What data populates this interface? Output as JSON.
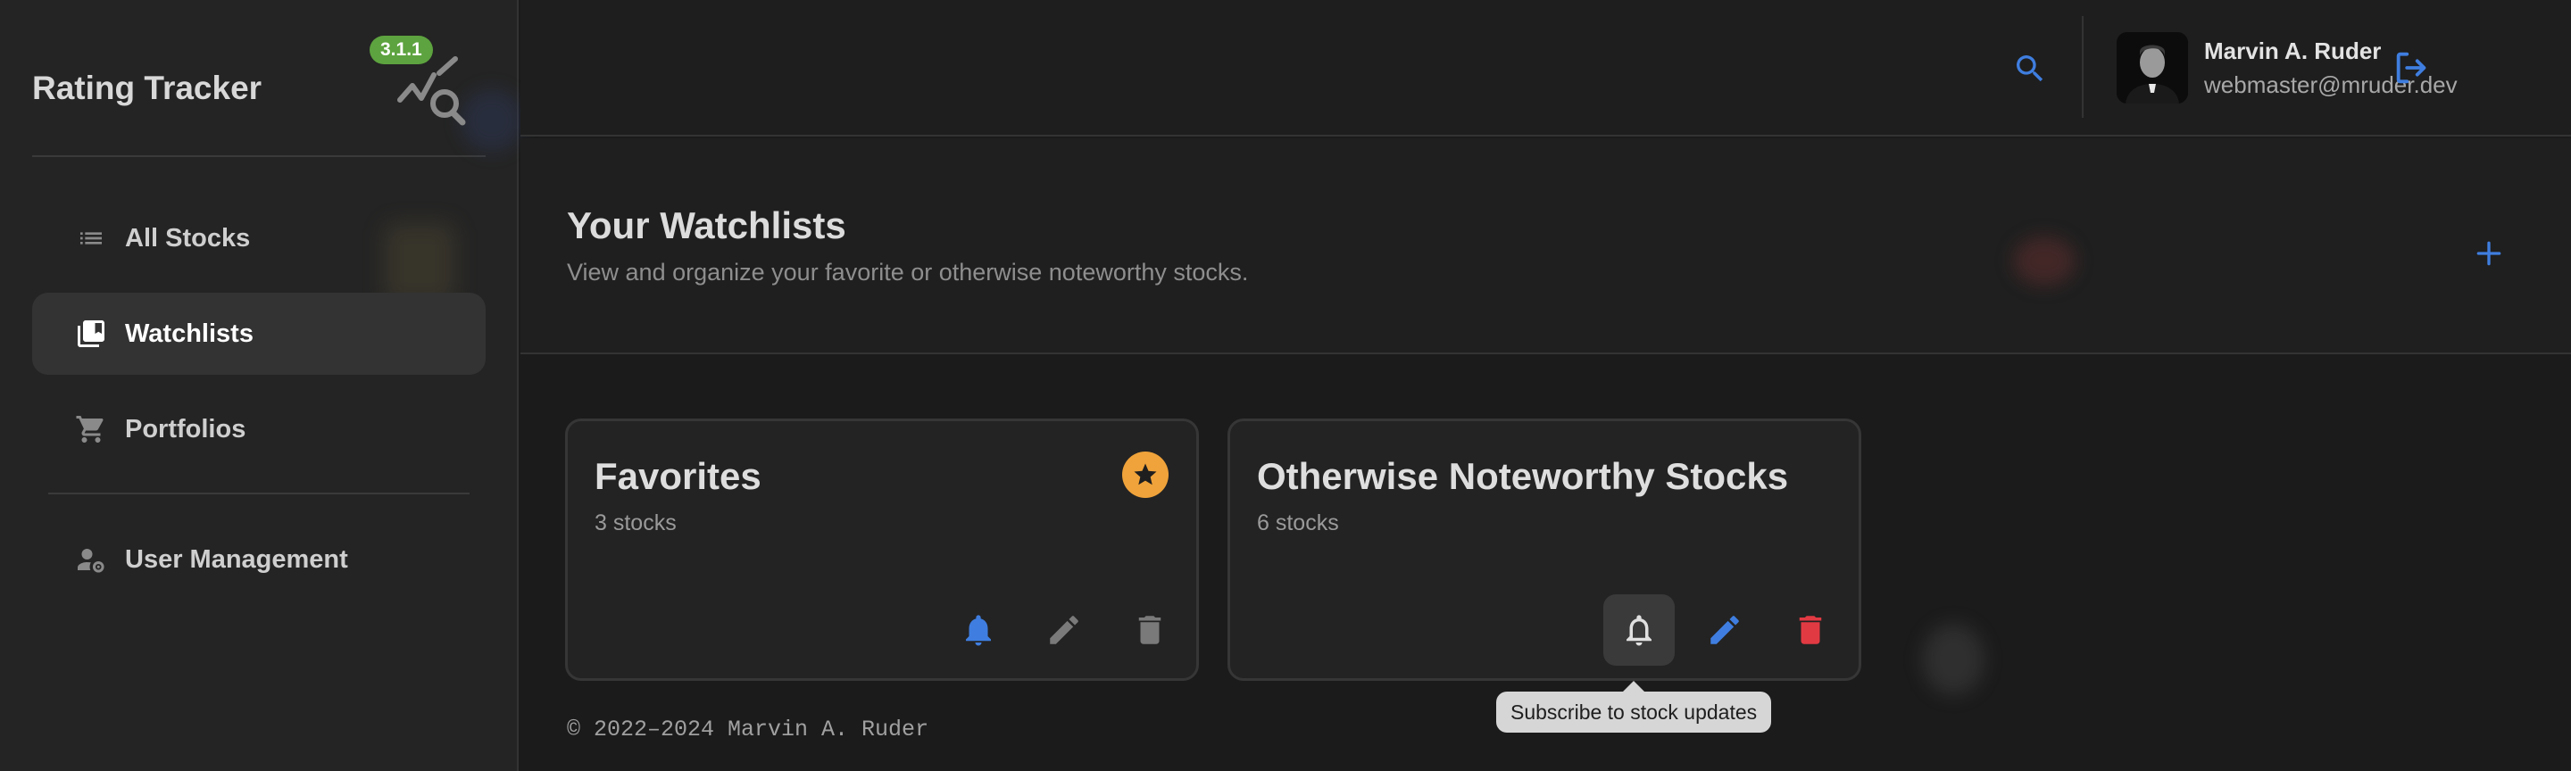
{
  "app": {
    "title": "Rating Tracker",
    "version": "3.1.1"
  },
  "sidebar": {
    "items": [
      {
        "label": "All Stocks",
        "icon": "list-icon"
      },
      {
        "label": "Watchlists",
        "icon": "watchlists-icon",
        "active": true
      },
      {
        "label": "Portfolios",
        "icon": "cart-icon"
      },
      {
        "label": "User Management",
        "icon": "user-management-icon"
      }
    ]
  },
  "header": {
    "user_name": "Marvin A. Ruder",
    "user_email": "webmaster@mruder.dev"
  },
  "page": {
    "title": "Your Watchlists",
    "subtitle": "View and organize your favorite or otherwise noteworthy stocks."
  },
  "watchlists": [
    {
      "name": "Favorites",
      "count": "3 stocks",
      "favorite": true
    },
    {
      "name": "Otherwise Noteworthy Stocks",
      "count": "6 stocks",
      "favorite": false
    }
  ],
  "tooltip": "Subscribe to stock updates",
  "footer": "© 2022–2024 Marvin A. Ruder",
  "colors": {
    "accent_blue": "#3f7ee0",
    "favorite_orange": "#f0a33a",
    "danger_red": "#e23a43",
    "version_green": "#5da33f"
  }
}
